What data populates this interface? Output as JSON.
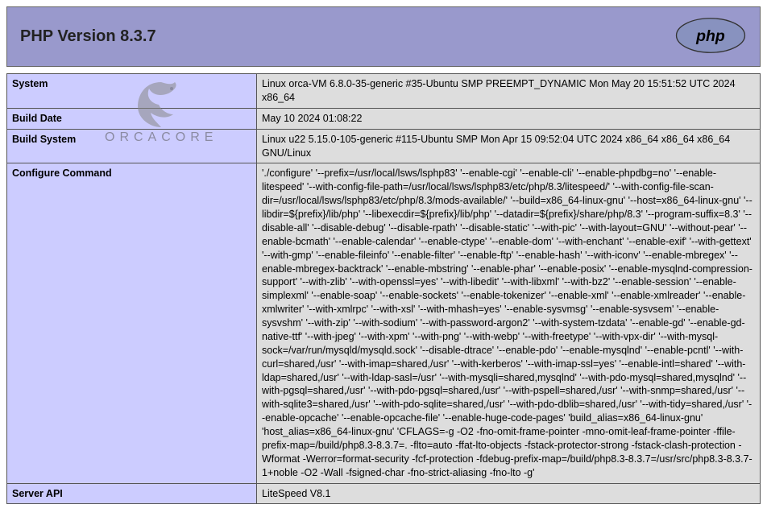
{
  "header": {
    "title": "PHP Version 8.3.7"
  },
  "watermark": {
    "text": "ORCACORE"
  },
  "rows": [
    {
      "label": "System",
      "value": "Linux orca-VM 6.8.0-35-generic #35-Ubuntu SMP PREEMPT_DYNAMIC Mon May 20 15:51:52 UTC 2024 x86_64"
    },
    {
      "label": "Build Date",
      "value": "May 10 2024 01:08:22"
    },
    {
      "label": "Build System",
      "value": "Linux u22 5.15.0-105-generic #115-Ubuntu SMP Mon Apr 15 09:52:04 UTC 2024 x86_64 x86_64 x86_64 GNU/Linux"
    },
    {
      "label": "Configure Command",
      "value": "'./configure' '--prefix=/usr/local/lsws/lsphp83' '--enable-cgi' '--enable-cli' '--enable-phpdbg=no' '--enable-litespeed' '--with-config-file-path=/usr/local/lsws/lsphp83/etc/php/8.3/litespeed/' '--with-config-file-scan-dir=/usr/local/lsws/lsphp83/etc/php/8.3/mods-available/' '--build=x86_64-linux-gnu' '--host=x86_64-linux-gnu' '--libdir=${prefix}/lib/php' '--libexecdir=${prefix}/lib/php' '--datadir=${prefix}/share/php/8.3' '--program-suffix=8.3' '--disable-all' '--disable-debug' '--disable-rpath' '--disable-static' '--with-pic' '--with-layout=GNU' '--without-pear' '--enable-bcmath' '--enable-calendar' '--enable-ctype' '--enable-dom' '--with-enchant' '--enable-exif' '--with-gettext' '--with-gmp' '--enable-fileinfo' '--enable-filter' '--enable-ftp' '--enable-hash' '--with-iconv' '--enable-mbregex' '--enable-mbregex-backtrack' '--enable-mbstring' '--enable-phar' '--enable-posix' '--enable-mysqlnd-compression-support' '--with-zlib' '--with-openssl=yes' '--with-libedit' '--with-libxml' '--with-bz2' '--enable-session' '--enable-simplexml' '--enable-soap' '--enable-sockets' '--enable-tokenizer' '--enable-xml' '--enable-xmlreader' '--enable-xmlwriter' '--with-xmlrpc' '--with-xsl' '--with-mhash=yes' '--enable-sysvmsg' '--enable-sysvsem' '--enable-sysvshm' '--with-zip' '--with-sodium' '--with-password-argon2' '--with-system-tzdata' '--enable-gd' '--enable-gd-native-ttf' '--with-jpeg' '--with-xpm' '--with-png' '--with-webp' '--with-freetype' '--with-vpx-dir' '--with-mysql-sock=/var/run/mysqld/mysqld.sock' '--disable-dtrace' '--enable-pdo' '--enable-mysqlnd' '--enable-pcntl' '--with-curl=shared,/usr' '--with-imap=shared,/usr' '--with-kerberos' '--with-imap-ssl=yes' '--enable-intl=shared' '--with-ldap=shared,/usr' '--with-ldap-sasl=/usr' '--with-mysqli=shared,mysqlnd' '--with-pdo-mysql=shared,mysqlnd' '--with-pgsql=shared,/usr' '--with-pdo-pgsql=shared,/usr' '--with-pspell=shared,/usr' '--with-snmp=shared,/usr' '--with-sqlite3=shared,/usr' '--with-pdo-sqlite=shared,/usr' '--with-pdo-dblib=shared,/usr' '--with-tidy=shared,/usr' '--enable-opcache' '--enable-opcache-file' '--enable-huge-code-pages' 'build_alias=x86_64-linux-gnu' 'host_alias=x86_64-linux-gnu' 'CFLAGS=-g -O2 -fno-omit-frame-pointer -mno-omit-leaf-frame-pointer -ffile-prefix-map=/build/php8.3-8.3.7=. -flto=auto -ffat-lto-objects -fstack-protector-strong -fstack-clash-protection -Wformat -Werror=format-security -fcf-protection -fdebug-prefix-map=/build/php8.3-8.3.7=/usr/src/php8.3-8.3.7-1+noble -O2 -Wall -fsigned-char -fno-strict-aliasing -fno-lto -g'"
    },
    {
      "label": "Server API",
      "value": "LiteSpeed V8.1"
    }
  ]
}
